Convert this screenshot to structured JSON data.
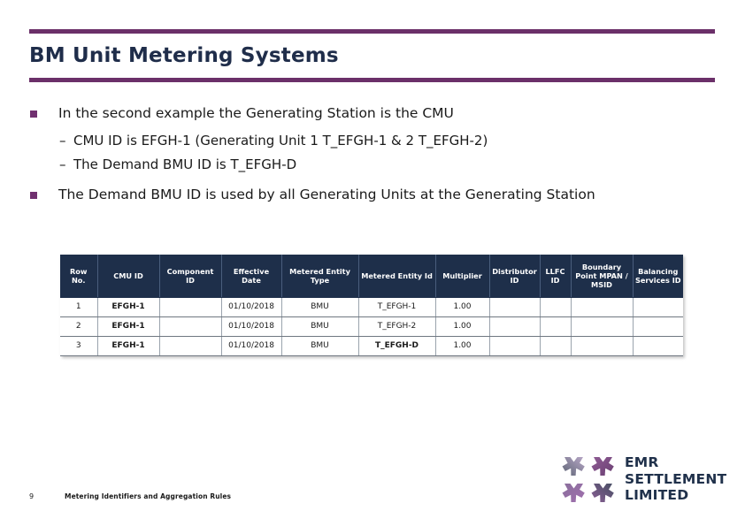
{
  "slide": {
    "title": "BM Unit Metering Systems",
    "accent_color": "#6b3069",
    "title_color": "#1f2d4a",
    "bullet_color": "#70306f",
    "table_header_color": "#1e2f4a"
  },
  "bullets": [
    {
      "level": 1,
      "text": "In the second example the Generating Station is the CMU"
    },
    {
      "level": 2,
      "dash": "–",
      "text": "CMU ID is EFGH-1 (Generating Unit 1 T_EFGH-1 & 2 T_EFGH-2)"
    },
    {
      "level": 2,
      "dash": "–",
      "text": "The Demand BMU ID is T_EFGH-D"
    },
    {
      "level": 1,
      "text": "The Demand BMU ID is used by all Generating Units at the Generating Station"
    }
  ],
  "table": {
    "columns": [
      "Row No.",
      "CMU ID",
      "Component ID",
      "Effective Date",
      "Metered Entity Type",
      "Metered Entity Id",
      "Multiplier",
      "Distributor ID",
      "LLFC ID",
      "Boundary Point MPAN / MSID",
      "Balancing Services ID"
    ],
    "rows": [
      {
        "row_no": "1",
        "cmu_id": "EFGH-1",
        "component_id": "",
        "effective_date": "01/10/2018",
        "metered_entity_type": "BMU",
        "metered_entity_id": "T_EFGH-1",
        "multiplier": "1.00",
        "distributor_id": "",
        "llfc_id": "",
        "boundary_point": "",
        "balancing_services_id": ""
      },
      {
        "row_no": "2",
        "cmu_id": "EFGH-1",
        "component_id": "",
        "effective_date": "01/10/2018",
        "metered_entity_type": "BMU",
        "metered_entity_id": "T_EFGH-2",
        "multiplier": "1.00",
        "distributor_id": "",
        "llfc_id": "",
        "boundary_point": "",
        "balancing_services_id": ""
      },
      {
        "row_no": "3",
        "cmu_id": "EFGH-1",
        "component_id": "",
        "effective_date": "01/10/2018",
        "metered_entity_type": "BMU",
        "metered_entity_id": "T_EFGH-D",
        "multiplier": "1.00",
        "distributor_id": "",
        "llfc_id": "",
        "boundary_point": "",
        "balancing_services_id": ""
      }
    ]
  },
  "footer": {
    "page_number": "9",
    "text": "Metering Identifiers and Aggregation Rules"
  },
  "logo": {
    "line1": "EMR",
    "line2": "SETTLEMENT",
    "line3": "LIMITED",
    "icon_name": "emr-pinwheel-mark"
  }
}
